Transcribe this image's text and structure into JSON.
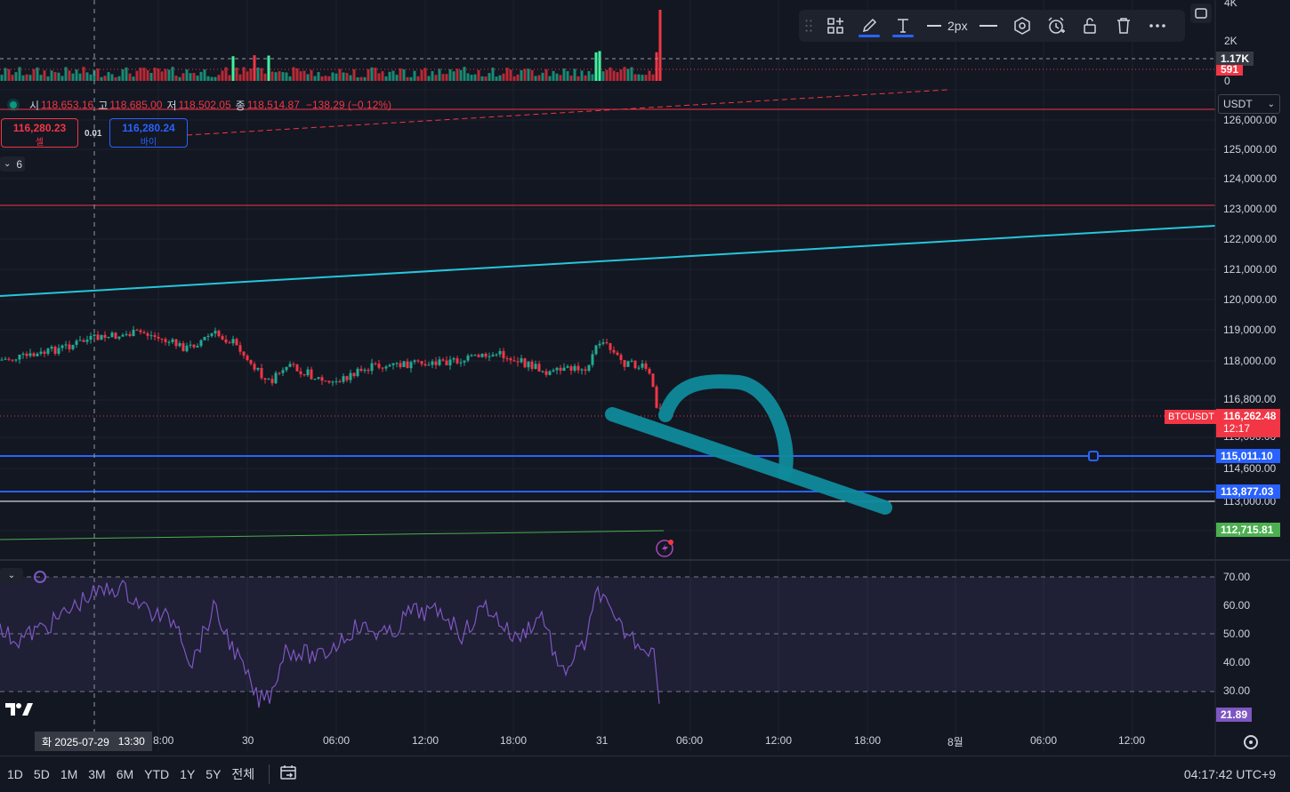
{
  "ohlc": {
    "open_label": "시",
    "open_value": "118,653.16",
    "high_label": "고",
    "high_value": "118,685.00",
    "low_label": "저",
    "low_value": "118,502.05",
    "close_label": "종",
    "close_value": "118,514.87",
    "change": "−138.29 (−0.12%)"
  },
  "trade": {
    "sell_price": "116,280.23",
    "sell_label": "셀",
    "spread": "0.01",
    "buy_price": "116,280.24",
    "buy_label": "바이"
  },
  "indicators_toggle": "6",
  "currency": "USDT",
  "volume_axis": {
    "labels": [
      "4K",
      "2K",
      "0"
    ],
    "tag_current": "1.17K",
    "tag_red": "591"
  },
  "price_axis": [
    "126,000.00",
    "125,000.00",
    "124,000.00",
    "123,000.00",
    "122,000.00",
    "121,000.00",
    "120,000.00",
    "119,000.00",
    "118,000.00",
    "116,800.00",
    "115,000.00",
    "114,600.00",
    "113,000.00"
  ],
  "price_tags": {
    "symbol": "BTCUSDT",
    "last_price": "116,262.48",
    "countdown": "12:17",
    "line1": "115,011.10",
    "line2": "113,877.03",
    "ma": "112,715.81"
  },
  "rsi_axis": [
    "70.00",
    "60.00",
    "50.00",
    "40.00",
    "30.00"
  ],
  "rsi_value": "21.89",
  "time_axis": [
    "8:00",
    "30",
    "06:00",
    "12:00",
    "18:00",
    "31",
    "06:00",
    "12:00",
    "18:00",
    "8월",
    "06:00",
    "12:00"
  ],
  "crosshair_date": "화 2025-07-29",
  "crosshair_time": "13:30",
  "toolbar": {
    "stroke_width": "2px"
  },
  "ranges": [
    "1D",
    "5D",
    "1M",
    "3M",
    "6M",
    "YTD",
    "1Y",
    "5Y",
    "전체"
  ],
  "clock": "04:17:42 UTC+9",
  "colors": {
    "bg": "#131722",
    "up": "#22ab94",
    "down": "#f23645",
    "cyan_line": "#26c6da",
    "blue_line": "#2962ff",
    "rsi": "#7e57c2",
    "brush": "#0f8a9b"
  }
}
